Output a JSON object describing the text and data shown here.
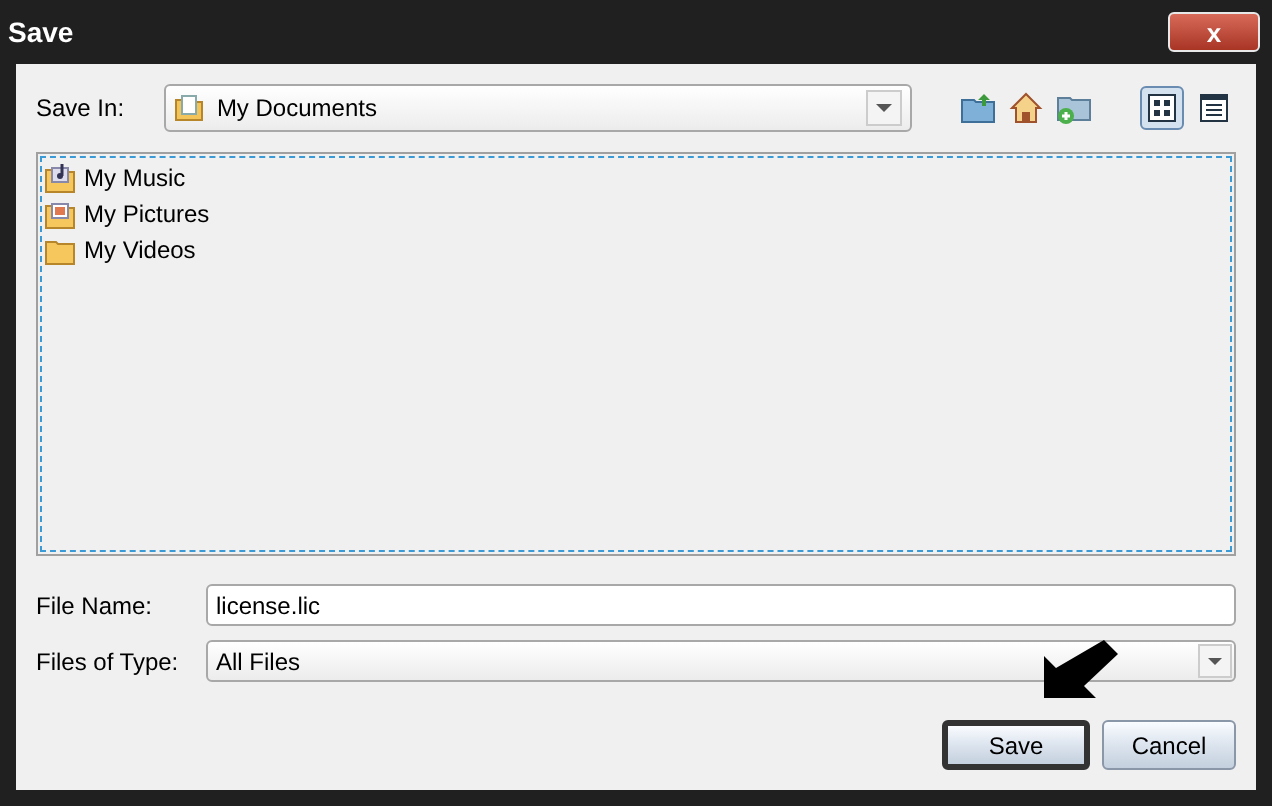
{
  "window": {
    "title": "Save",
    "close_label": "x"
  },
  "save_in": {
    "label": "Save In:",
    "value": "My Documents"
  },
  "view_buttons": [
    {
      "kind": "list",
      "selected": true
    },
    {
      "kind": "details",
      "selected": false
    }
  ],
  "files": [
    {
      "name": "My Music",
      "kind": "music"
    },
    {
      "name": "My Pictures",
      "kind": "pictures"
    },
    {
      "name": "My Videos",
      "kind": "folder"
    }
  ],
  "file_name": {
    "label": "File Name:",
    "value": "license.lic"
  },
  "file_type": {
    "label": "Files of Type:",
    "value": "All Files"
  },
  "buttons": [
    {
      "label": "Save",
      "default": true
    },
    {
      "label": "Cancel",
      "default": false
    }
  ]
}
